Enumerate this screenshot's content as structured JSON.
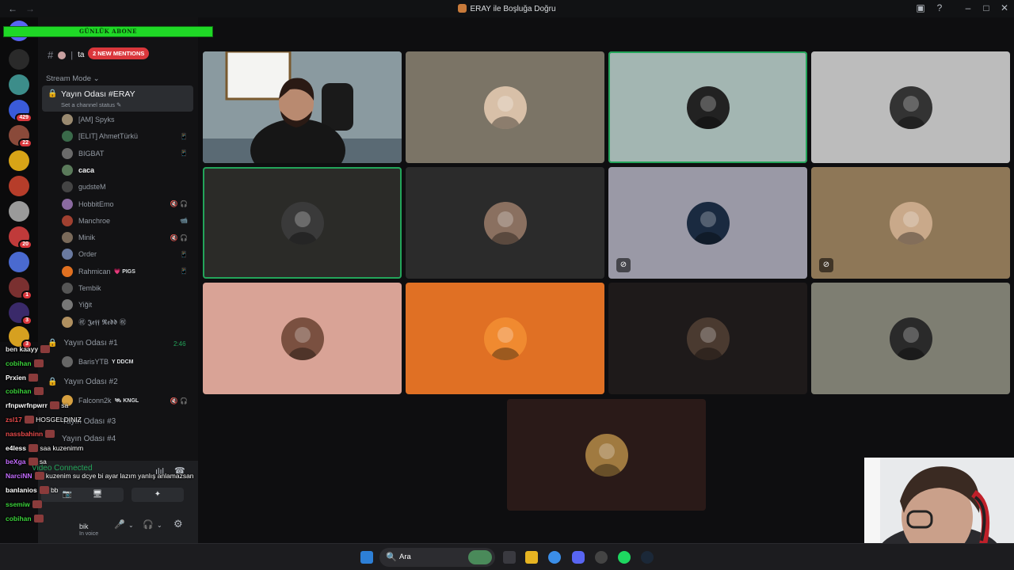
{
  "window": {
    "title": "ERAY ile Boşluğa Doğru",
    "back": "←",
    "forward": "→"
  },
  "overlay": {
    "banner": "GÜNLÜK ABONE"
  },
  "servers": {
    "badges": [
      "429",
      "22",
      "20",
      "1",
      "3",
      "3"
    ]
  },
  "channel_header": {
    "hash": "#",
    "name": "ta",
    "mentions": "2 NEW MENTIONS"
  },
  "stream_mode": "Stream Mode ⌄",
  "active_voice": {
    "name": "Yayın Odası #ERAY",
    "status": "Set a channel status ✎",
    "members": [
      {
        "name": "[AM] Spyks",
        "icon": ""
      },
      {
        "name": "[ELIT] AhmetTürkü",
        "icon": "📱"
      },
      {
        "name": "BIGBAT",
        "icon": "📱"
      },
      {
        "name": "caca",
        "icon": ""
      },
      {
        "name": "gudsteM",
        "icon": ""
      },
      {
        "name": "HobbitEmo",
        "icon": "🔇 🎧"
      },
      {
        "name": "Manchroe",
        "icon": "📹"
      },
      {
        "name": "Minik",
        "icon": "🔇 🎧"
      },
      {
        "name": "Order",
        "icon": "📱"
      },
      {
        "name": "Rahmican",
        "tag": "💗 PIGS",
        "icon": "📱"
      },
      {
        "name": "Tembik",
        "icon": ""
      },
      {
        "name": "Yiğit",
        "icon": ""
      },
      {
        "name": "㊗ 𝕵𝖊𝖋𝖋 𝕽𝖊𝖉𝖉 ㊗",
        "icon": ""
      }
    ]
  },
  "other_voice": [
    {
      "name": "Yayın Odası #1",
      "time": "2:46"
    },
    {
      "member": "BarisYTB",
      "tag": "Y DDCM"
    },
    {
      "name": "Yayın Odası #2"
    },
    {
      "member": "Falconn2k",
      "tag": "🛰 KNGL",
      "icon": "🔇 🎧"
    },
    {
      "name": "Yayın Odası #3"
    },
    {
      "name": "Yayın Odası #4"
    }
  ],
  "voice_panel": {
    "connected": "Video Connected",
    "btn_camera": "📷",
    "btn_share": "🖥",
    "btn_activity": "✦",
    "user": "bik",
    "user_status": "In voice",
    "mic": "🎤",
    "headset": "🎧",
    "settings": "⚙"
  },
  "chat": [
    {
      "user": "ben kaayy",
      "msg": "",
      "color": "#e0e0e0"
    },
    {
      "user": "cobihan",
      "msg": "",
      "color": "#3ad13a"
    },
    {
      "user": "Prxien",
      "msg": "",
      "color": "#ffffff"
    },
    {
      "user": "cobihan",
      "msg": "",
      "color": "#3ad13a"
    },
    {
      "user": "rfnpwrfnpwrr",
      "msg": "sa",
      "color": "#ffffff"
    },
    {
      "user": "zsl17",
      "msg": "HOSGELDINIZ",
      "color": "#e84b4b"
    },
    {
      "user": "nassbahinn",
      "msg": "",
      "color": "#e84b4b"
    },
    {
      "user": "e4less",
      "msg": "saa kuzenimm",
      "color": "#ffffff"
    },
    {
      "user": "beXga",
      "msg": "sa",
      "color": "#c46cff"
    },
    {
      "user": "NarciNN",
      "msg": "kuzenim su dcye bi ayar lazım yanlış anlamazsan",
      "color": "#c46cff"
    },
    {
      "user": "banlanios",
      "msg": "bb",
      "color": "#ffffff"
    },
    {
      "user": "ssemiw",
      "msg": "",
      "color": "#3ad13a"
    },
    {
      "user": "cobihan",
      "msg": "",
      "color": "#3ad13a"
    }
  ],
  "taskbar": {
    "search": "Ara",
    "search_icon": "🔍"
  },
  "colors": {
    "speaking": "#23a55a",
    "mention": "#da373c",
    "overlay": "#1fd826"
  }
}
